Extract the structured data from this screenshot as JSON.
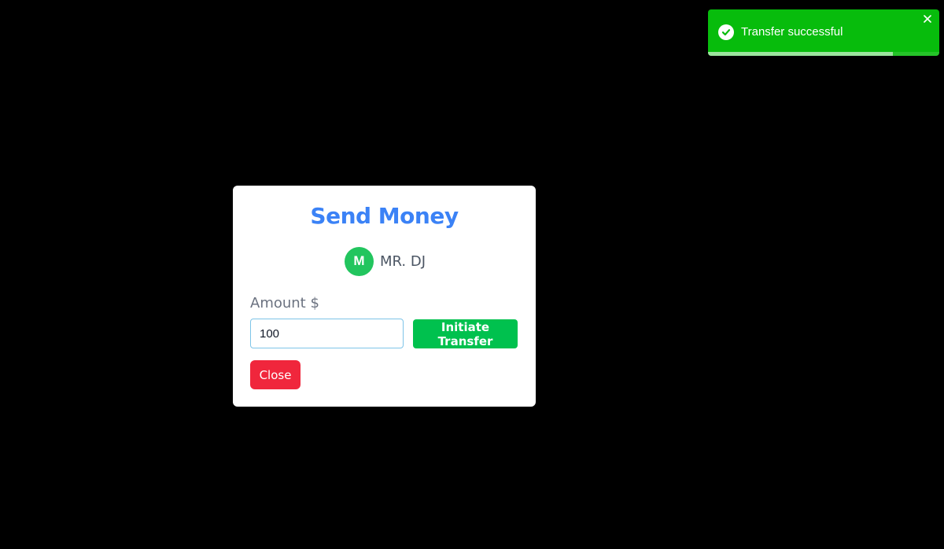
{
  "toast": {
    "message": "Transfer successful",
    "status_color": "#07bc0c",
    "icon": "check-circle-icon",
    "close_icon": "close-icon",
    "progress_fraction": 0.8
  },
  "modal": {
    "title": "Send Money",
    "recipient": {
      "initial": "M",
      "name": "MR. DJ"
    },
    "amount_label": "Amount $",
    "amount_value": "100",
    "initiate_button": "Initiate Transfer",
    "close_button": "Close",
    "accent_color": "#3b82f6",
    "success_color": "#00c14e",
    "danger_color": "#f0263c"
  }
}
